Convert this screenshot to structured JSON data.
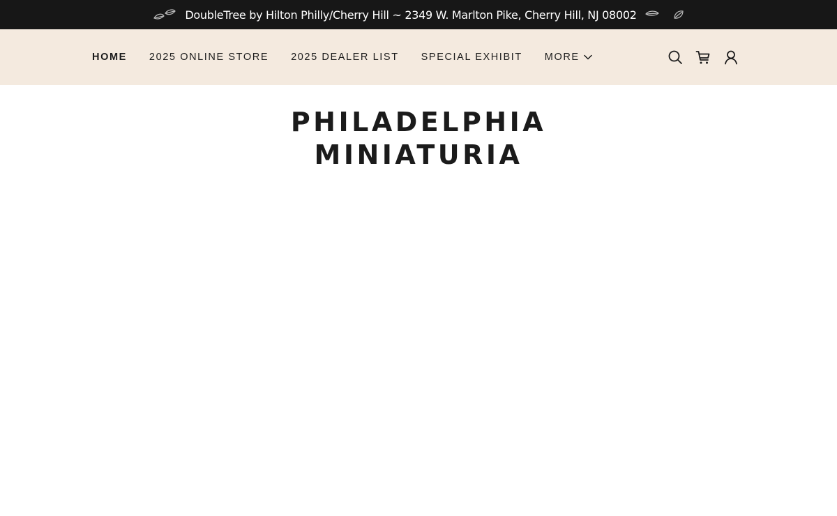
{
  "announcement": {
    "text": "DoubleTree by Hilton Philly/Cherry Hill ~ 2349 W. Marlton Pike, Cherry Hill, NJ 08002",
    "icons": [
      "leaf-icon",
      "leaf-icon",
      "leaf-icon",
      "leaf-icon"
    ]
  },
  "nav": {
    "items": [
      {
        "label": "HOME",
        "active": true
      },
      {
        "label": "2025 ONLINE STORE"
      },
      {
        "label": "2025 DEALER LIST"
      },
      {
        "label": "SPECIAL EXHIBIT"
      },
      {
        "label": "MORE",
        "icon": "chevron-down-icon"
      }
    ],
    "icons": [
      "search-icon",
      "cart-icon",
      "account-icon"
    ]
  },
  "hero": {
    "title_line1": "PHILADELPHIA",
    "title_line2": "MINIATURIA"
  },
  "colors": {
    "announce_bg": "#171717",
    "nav_bg": "#f4eadf",
    "text": "#1b1b1b"
  }
}
